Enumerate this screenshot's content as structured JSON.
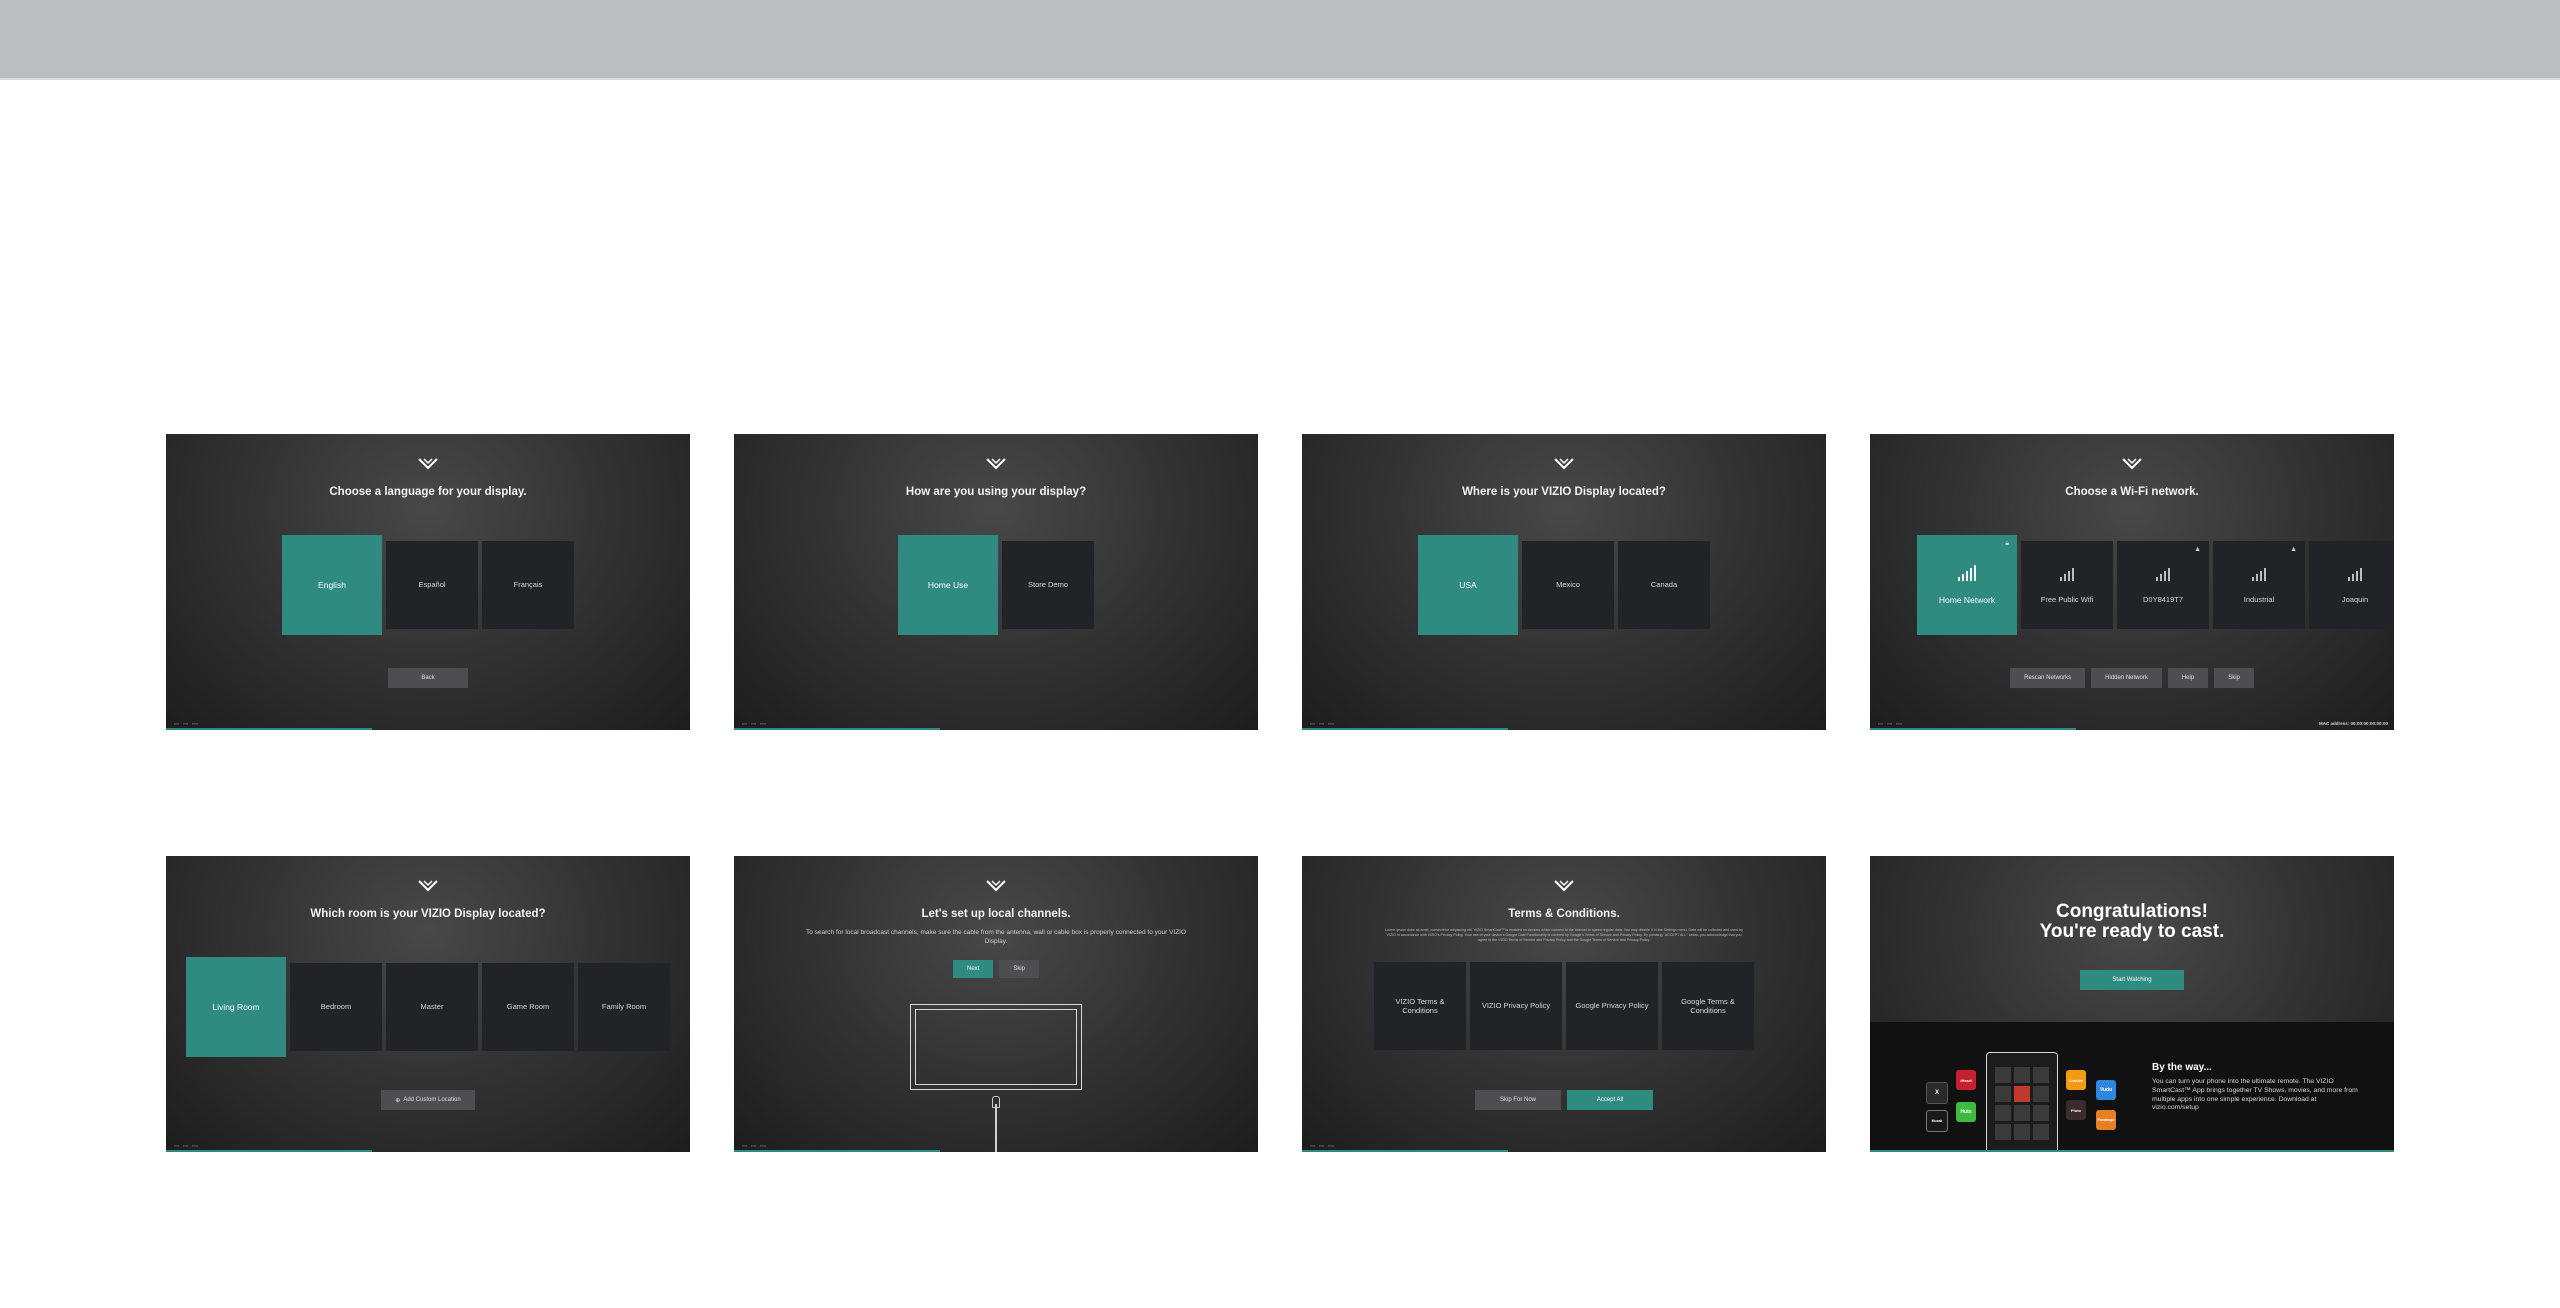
{
  "screens": {
    "language": {
      "title": "Choose a language for your display.",
      "tiles": [
        "English",
        "Español",
        "Français"
      ],
      "back": "Back"
    },
    "usage": {
      "title": "How are you using your display?",
      "tiles": [
        "Home Use",
        "Store Demo"
      ]
    },
    "location": {
      "title": "Where is your VIZIO Display located?",
      "tiles": [
        "USA",
        "Mexico",
        "Canada"
      ]
    },
    "wifi": {
      "title": "Choose a Wi-Fi network.",
      "networks": [
        "Home Network",
        "Free Public Wifi",
        "D0Y8419T7",
        "Industrial",
        "Joaquin"
      ],
      "buttons": [
        "Rescan Networks",
        "Hidden Network",
        "Help",
        "Skip"
      ],
      "mac": "MAC address: 00:00:00:00:00:00"
    },
    "room": {
      "title": "Which room is your VIZIO Display located?",
      "tiles": [
        "Living Room",
        "Bedroom",
        "Master",
        "Game Room",
        "Family Room"
      ],
      "custom": "Add Custom Location"
    },
    "channels": {
      "title": "Let's set up local channels.",
      "description": "To search for local broadcast channels, make sure the cable from the antenna, wall or cable box is properly connected to your VIZIO Display.",
      "next": "Next",
      "skip": "Skip"
    },
    "terms": {
      "title": "Terms & Conditions.",
      "fine": "Lorem ipsum dolor sit amet, consectetur adipiscing elit. VIZIO SmartCast™ is enabled on devices which connect to the internet to speed regular data. You may disable it in the Settings menu. Data will be collected and used by VIZIO in accordance with VIZIO's Privacy Policy. Your use of your device's Google Cast Functionality is covered by Google's Terms of Service and Privacy Policy. By pressing \"ACCEPT ALL\" below, you acknowledge that you agree to the VIZIO Terms of Service and Privacy Policy and the Google Terms of Service and Privacy Policy.",
      "tiles": [
        "VIZIO Terms & Conditions",
        "VIZIO Privacy Policy",
        "Google Privacy Policy",
        "Google Terms & Conditions"
      ],
      "skip": "Skip For Now",
      "accept": "Accept All"
    },
    "congrats": {
      "line1": "Congratulations!",
      "line2": "You're ready to cast.",
      "button": "Start Watching",
      "by_the_way": "By the way...",
      "text": "You can turn your phone into the ultimate remote. The VIZIO SmartCast™ App brings together TV Shows, movies, and more from multiple apps into one simple experience. Download at vizio.com/setup"
    }
  },
  "apps": [
    "X",
    "iHeart",
    "Hulu",
    "Crackle",
    "Vudu",
    "Fandango",
    "Pluto",
    "Muzak"
  ],
  "colors": {
    "accent": "#2f8a80",
    "tile": "#222326",
    "topbar": "#bcbdc0"
  }
}
